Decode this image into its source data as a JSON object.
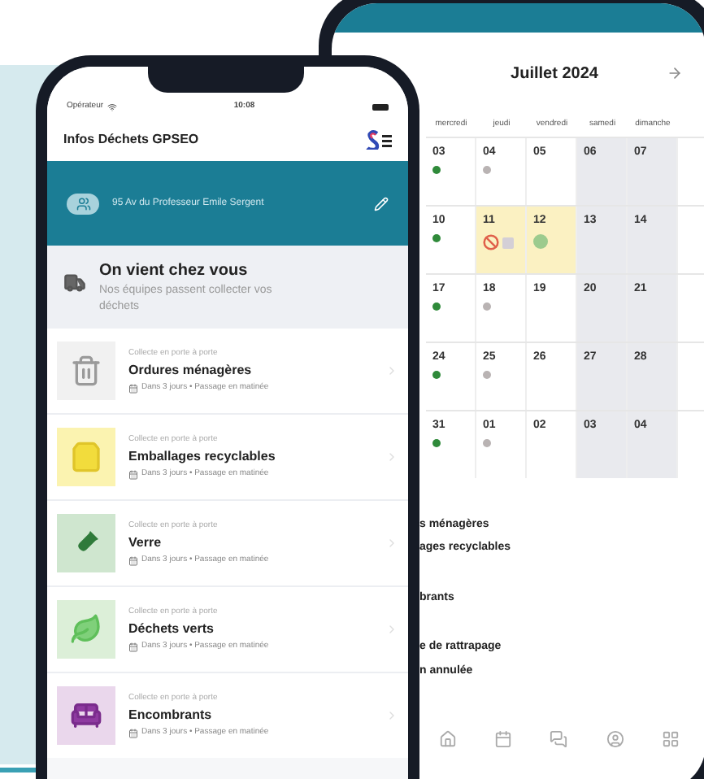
{
  "back_phone": {
    "calendar": {
      "month": "Juillet 2024",
      "weekdays": [
        "mercredi",
        "jeudi",
        "vendredi",
        "samedi",
        "dimanche"
      ],
      "weeks": [
        {
          "days": [
            {
              "date": "03",
              "weekend": false,
              "highlighted": false,
              "markers": [
                {
                  "kind": "dot",
                  "color": "#2f8a3a"
                }
              ]
            },
            {
              "date": "04",
              "weekend": false,
              "highlighted": false,
              "markers": [
                {
                  "kind": "dot",
                  "color": "#b9b3b3"
                }
              ]
            },
            {
              "date": "05",
              "weekend": false,
              "highlighted": false
            },
            {
              "date": "06",
              "weekend": true,
              "highlighted": false
            },
            {
              "date": "07",
              "weekend": true,
              "highlighted": false
            }
          ]
        },
        {
          "days": [
            {
              "date": "10",
              "weekend": false,
              "highlighted": false,
              "markers": [
                {
                  "kind": "dot",
                  "color": "#2f8a3a"
                }
              ]
            },
            {
              "date": "11",
              "weekend": false,
              "highlighted": true,
              "markers": [
                {
                  "kind": "forbidden",
                  "color": "#e0604a"
                },
                {
                  "kind": "square",
                  "color": "#d4cfd6"
                }
              ]
            },
            {
              "date": "12",
              "weekend": false,
              "highlighted": true,
              "markers": [
                {
                  "kind": "circle",
                  "color": "#9ccb8e"
                }
              ]
            },
            {
              "date": "13",
              "weekend": true,
              "highlighted": false
            },
            {
              "date": "14",
              "weekend": true,
              "highlighted": false
            }
          ]
        },
        {
          "days": [
            {
              "date": "17",
              "weekend": false,
              "highlighted": false,
              "markers": [
                {
                  "kind": "dot",
                  "color": "#2f8a3a"
                }
              ]
            },
            {
              "date": "18",
              "weekend": false,
              "highlighted": false,
              "markers": [
                {
                  "kind": "dot",
                  "color": "#b9b3b3"
                }
              ]
            },
            {
              "date": "19",
              "weekend": false,
              "highlighted": false
            },
            {
              "date": "20",
              "weekend": true,
              "highlighted": false
            },
            {
              "date": "21",
              "weekend": true,
              "highlighted": false
            }
          ]
        },
        {
          "days": [
            {
              "date": "24",
              "weekend": false,
              "highlighted": false,
              "markers": [
                {
                  "kind": "dot",
                  "color": "#2f8a3a"
                }
              ]
            },
            {
              "date": "25",
              "weekend": false,
              "highlighted": false,
              "markers": [
                {
                  "kind": "dot",
                  "color": "#b9b3b3"
                }
              ]
            },
            {
              "date": "26",
              "weekend": false,
              "highlighted": false
            },
            {
              "date": "27",
              "weekend": true,
              "highlighted": false
            },
            {
              "date": "28",
              "weekend": true,
              "highlighted": false
            }
          ]
        },
        {
          "days": [
            {
              "date": "31",
              "weekend": false,
              "highlighted": false,
              "markers": [
                {
                  "kind": "dot",
                  "color": "#2f8a3a"
                }
              ]
            },
            {
              "date": "01",
              "weekend": false,
              "highlighted": false,
              "markers": [
                {
                  "kind": "dot",
                  "color": "#b9b3b3"
                }
              ]
            },
            {
              "date": "02",
              "weekend": false,
              "highlighted": false
            },
            {
              "date": "03",
              "weekend": true,
              "highlighted": false
            },
            {
              "date": "04",
              "weekend": true,
              "highlighted": false
            }
          ]
        }
      ]
    },
    "legend_groups": [
      [
        "s ménagères",
        "ages recyclables"
      ],
      [
        "brants"
      ],
      [
        "e de rattrapage",
        "n annulée"
      ]
    ]
  },
  "front_phone": {
    "status_bar": {
      "carrier": "Opérateur",
      "time": "10:08"
    },
    "app_title": "Infos Déchets GPSEO",
    "address": "95 Av du Professeur Emile Sergent",
    "notice": {
      "title": "On vient chez vous",
      "text": "Nos équipes passent collecter vos déchets"
    },
    "collections": [
      {
        "kind": "bin",
        "color": "#f1f1f1",
        "category": "Collecte en porte à porte",
        "name": "Ordures ménagères",
        "schedule": "Dans 3 jours • Passage en matinée"
      },
      {
        "kind": "recycling",
        "color": "#fbf3b0",
        "category": "Collecte en porte à porte",
        "name": "Emballages recyclables",
        "schedule": "Dans 3 jours • Passage en matinée"
      },
      {
        "kind": "glass",
        "color": "#cfe6cf",
        "category": "Collecte en porte à porte",
        "name": "Verre",
        "schedule": "Dans 3 jours • Passage en matinée"
      },
      {
        "kind": "green",
        "color": "#dcefd8",
        "category": "Collecte en porte à porte",
        "name": "Déchets verts",
        "schedule": "Dans 3 jours • Passage en matinée"
      },
      {
        "kind": "bulky",
        "color": "#ead7ec",
        "category": "Collecte en porte à porte",
        "name": "Encombrants",
        "schedule": "Dans 3 jours • Passage en matinée"
      }
    ]
  }
}
